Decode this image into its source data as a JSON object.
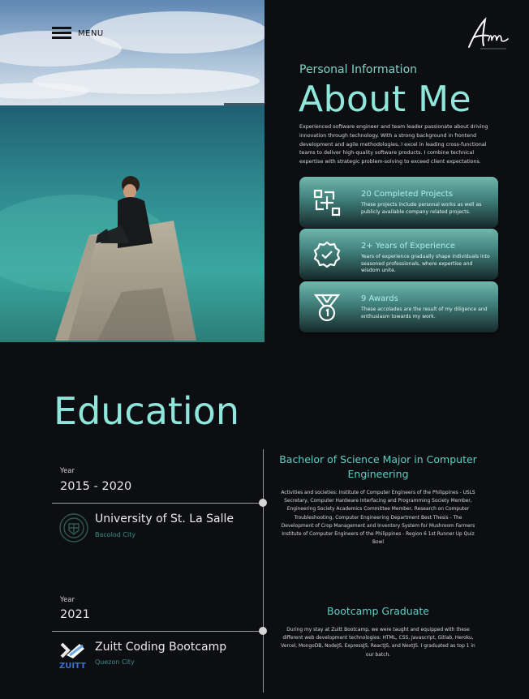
{
  "nav": {
    "menu_label": "MENU"
  },
  "logo": {
    "icon": "signature-logo",
    "text": "Am"
  },
  "about": {
    "subtitle": "Personal Information",
    "title": "About Me",
    "description": "Experienced software engineer and team leader passionate about driving innovation through technology. With a strong background in frontend development and agile methodologies, I excel in leading cross-functional teams to deliver high-quality software products. I combine technical expertise with strategic problem-solving to exceed client expectations.",
    "cards": [
      {
        "icon": "projects-icon",
        "title": "20 Completed Projects",
        "text": "These projects include personal works as well as publicly available company related projects."
      },
      {
        "icon": "badge-check-icon",
        "title": "2+ Years of Experience",
        "text": "Years of experience gradually shape individuals into seasoned professionals, where expertise and wisdom unite."
      },
      {
        "icon": "medal-icon",
        "title": "9 Awards",
        "text": "These accolades are the result of my diligence and enthusiasm towards my work."
      }
    ]
  },
  "education": {
    "title": "Education",
    "entries": [
      {
        "year_label": "Year",
        "year": "2015 - 2020",
        "school": "University of St. La Salle",
        "location": "Bacolod City",
        "degree": "Bachelor of Science Major in Computer Engineering",
        "details": "Activities and societies: Institute of Computer Engineers of the Philippines - USLS Secretary, Computer Hardware Interfacing and Programming Society Member, Engineering Society Academics Committee Member, Research on Computer Troubleshooting, Computer Engineering Department Best Thesis - The Development of Crop Management and Inventory System for Mushroom Farmers Institute of Computer Engineers of the Philippines - Region 6 1st Runner Up Quiz Bowl"
      },
      {
        "year_label": "Year",
        "year": "2021",
        "school": "Zuitt Coding Bootcamp",
        "location": "Quezon City",
        "logo_text": "ZUITT",
        "degree": "Bootcamp Graduate",
        "details": "During my stay at Zuitt Bootcamp, we were taught and equipped with these different web development technologies: HTML, CSS, Javascript, Gitlab, Heroku, Vercel, MongoDB, NodeJS, ExpressJS, ReactJS, and NextJS. I graduated as top 1 in our batch."
      }
    ]
  },
  "colors": {
    "accent": "#8fe6db",
    "background": "#0d0e12",
    "card": "#4e9690"
  }
}
